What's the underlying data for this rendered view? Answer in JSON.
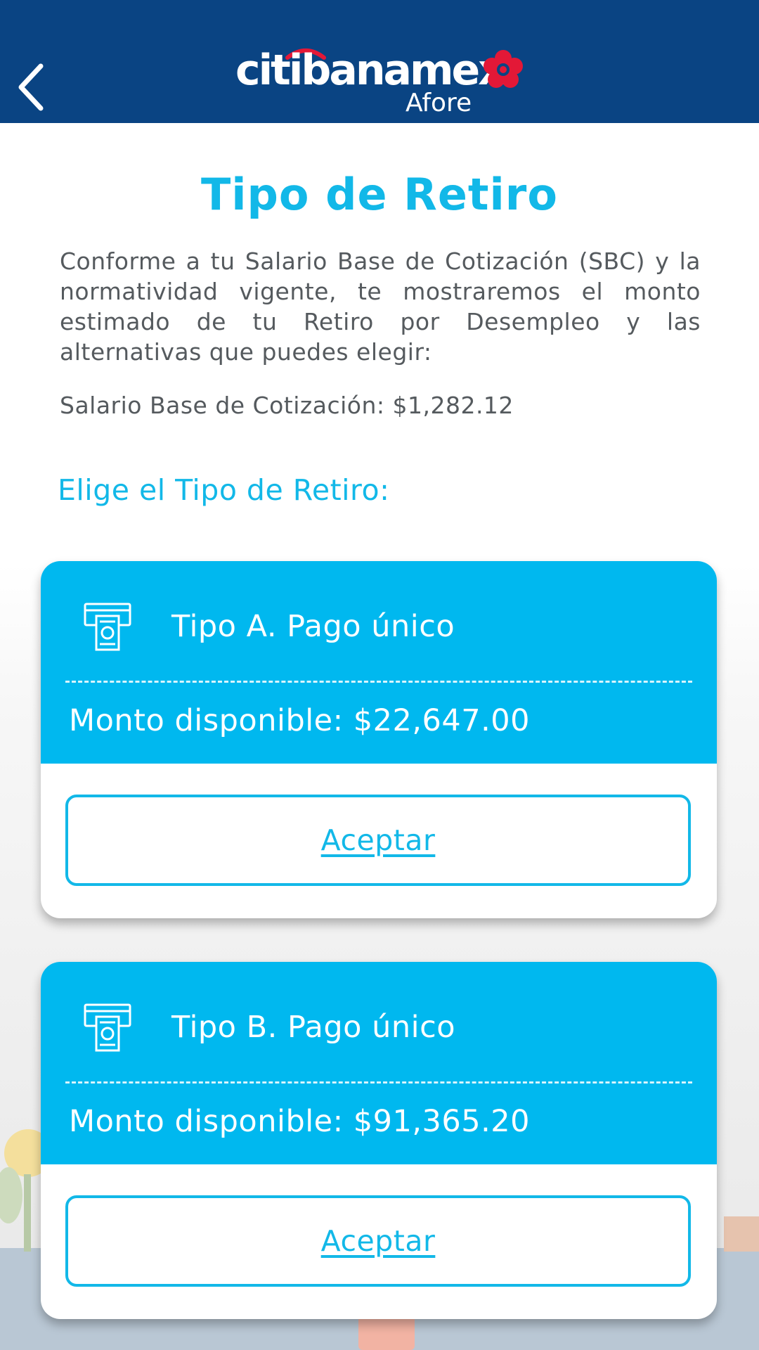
{
  "header": {
    "brand": "citibanamex",
    "subbrand": "Afore",
    "background_color": "#0a4483",
    "brand_accent_color": "#e31837"
  },
  "main": {
    "title": "Tipo de Retiro",
    "intro": "Conforme a tu Salario Base de Cotización (SBC) y la normatividad vigente, te mostraremos el monto estimado de tu Retiro por Desempleo y las alternativas que puedes elegir:",
    "sbc_line": "Salario Base de Cotización: $1,282.12",
    "choose_label": "Elige el Tipo de Retiro:",
    "accent_color": "#12b8e8"
  },
  "options": [
    {
      "icon": "atm-cash-icon",
      "title": "Tipo A. Pago único",
      "amount": "Monto disponible: $22,647.00",
      "button_label": "Aceptar"
    },
    {
      "icon": "atm-cash-icon",
      "title": "Tipo B. Pago único",
      "amount": "Monto disponible: $91,365.20",
      "button_label": "Aceptar"
    }
  ]
}
